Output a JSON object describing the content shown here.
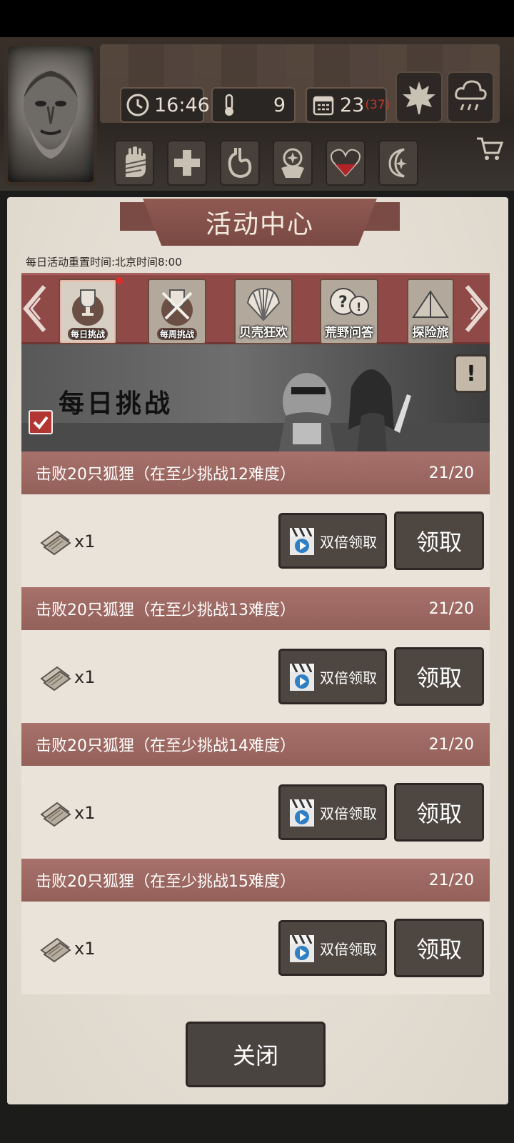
{
  "hud": {
    "time": "16:46",
    "temperature": "9",
    "day": "23",
    "day_extra": "(37)",
    "state_icons": [
      "bandage-hand-icon",
      "medical-cross-icon",
      "stomach-icon",
      "mind-icon",
      "heart-icon",
      "moon-icon"
    ],
    "heart_fill": 0.5
  },
  "panel": {
    "title": "活动中心",
    "reset_notice": "每日活动重置时间:北京时间8:00"
  },
  "tabs": [
    {
      "label": "每日挑战",
      "active": true,
      "badge": true
    },
    {
      "label": "每周挑战",
      "active": false
    },
    {
      "label": "贝壳狂欢",
      "active": false
    },
    {
      "label": "荒野问答",
      "active": false
    },
    {
      "label": "探险旅",
      "active": false
    }
  ],
  "banner": {
    "title": "每日挑战",
    "info_label": "!"
  },
  "tasks": [
    {
      "title": "击败20只狐狸（在至少挑战12难度）",
      "progress": "21/20",
      "reward_qty": "x1",
      "double_label": "双倍领取",
      "claim_label": "领取"
    },
    {
      "title": "击败20只狐狸（在至少挑战13难度）",
      "progress": "21/20",
      "reward_qty": "x1",
      "double_label": "双倍领取",
      "claim_label": "领取"
    },
    {
      "title": "击败20只狐狸（在至少挑战14难度）",
      "progress": "21/20",
      "reward_qty": "x1",
      "double_label": "双倍领取",
      "claim_label": "领取"
    },
    {
      "title": "击败20只狐狸（在至少挑战15难度）",
      "progress": "21/20",
      "reward_qty": "x1",
      "double_label": "双倍领取",
      "claim_label": "领取"
    }
  ],
  "close_label": "关闭",
  "colors": {
    "ribbon": "#8f4a48",
    "task_header": "#a8716b",
    "button": "#4d4641",
    "badge": "#e02b2b"
  }
}
